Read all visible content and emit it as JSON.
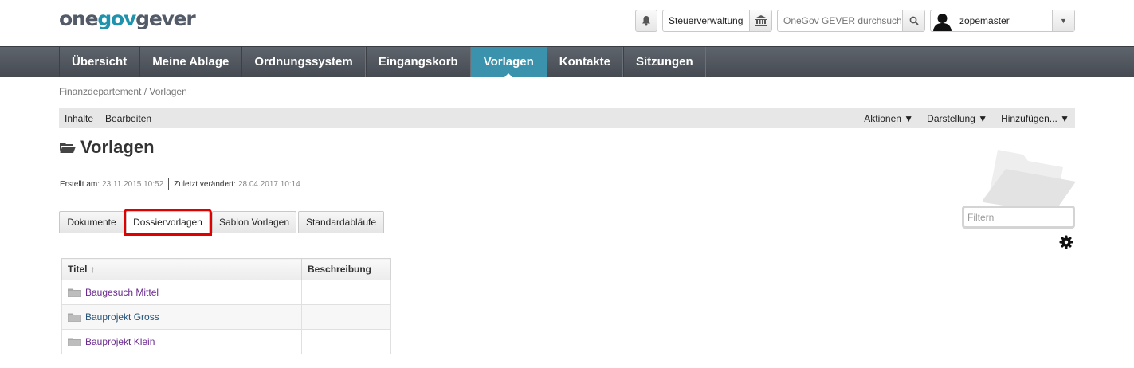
{
  "header": {
    "logo": {
      "part1": "one",
      "part2": "gov",
      "part3": "gever"
    },
    "org_selector": "Steuerverwaltung",
    "search": {
      "placeholder": "OneGov GEVER durchsuchen"
    },
    "user": {
      "name": "zopemaster"
    }
  },
  "nav": {
    "items": [
      {
        "label": "Übersicht"
      },
      {
        "label": "Meine Ablage"
      },
      {
        "label": "Ordnungssystem"
      },
      {
        "label": "Eingangskorb"
      },
      {
        "label": "Vorlagen",
        "active": true
      },
      {
        "label": "Kontakte"
      },
      {
        "label": "Sitzungen"
      }
    ],
    "active_color": "#3a92ac"
  },
  "breadcrumb": "Finanzdepartement / Vorlagen",
  "toolbar": {
    "left": [
      "Inhalte",
      "Bearbeiten"
    ],
    "right": [
      "Aktionen ▼",
      "Darstellung ▼",
      "Hinzufügen... ▼"
    ]
  },
  "page": {
    "title": "Vorlagen",
    "created_label": "Erstellt am:",
    "created_value": "23.11.2015 10:52",
    "modified_label": "Zuletzt verändert:",
    "modified_value": "28.04.2017 10:14"
  },
  "tabs": [
    {
      "label": "Dokumente"
    },
    {
      "label": "Dossiervorlagen",
      "active": true
    },
    {
      "label": "Sablon Vorlagen"
    },
    {
      "label": "Standardabläufe"
    }
  ],
  "filter": {
    "placeholder": "Filtern"
  },
  "table": {
    "headers": {
      "title": "Titel",
      "sort_indicator": "↑",
      "description": "Beschreibung"
    },
    "rows": [
      {
        "title": "Baugesuch Mittel",
        "description": ""
      },
      {
        "title": "Bauprojekt Gross",
        "description": ""
      },
      {
        "title": "Bauprojekt Klein",
        "description": ""
      }
    ]
  },
  "colors": {
    "highlight": "#e10000",
    "visited_link": "#6b2a8f",
    "link": "#27547a"
  }
}
